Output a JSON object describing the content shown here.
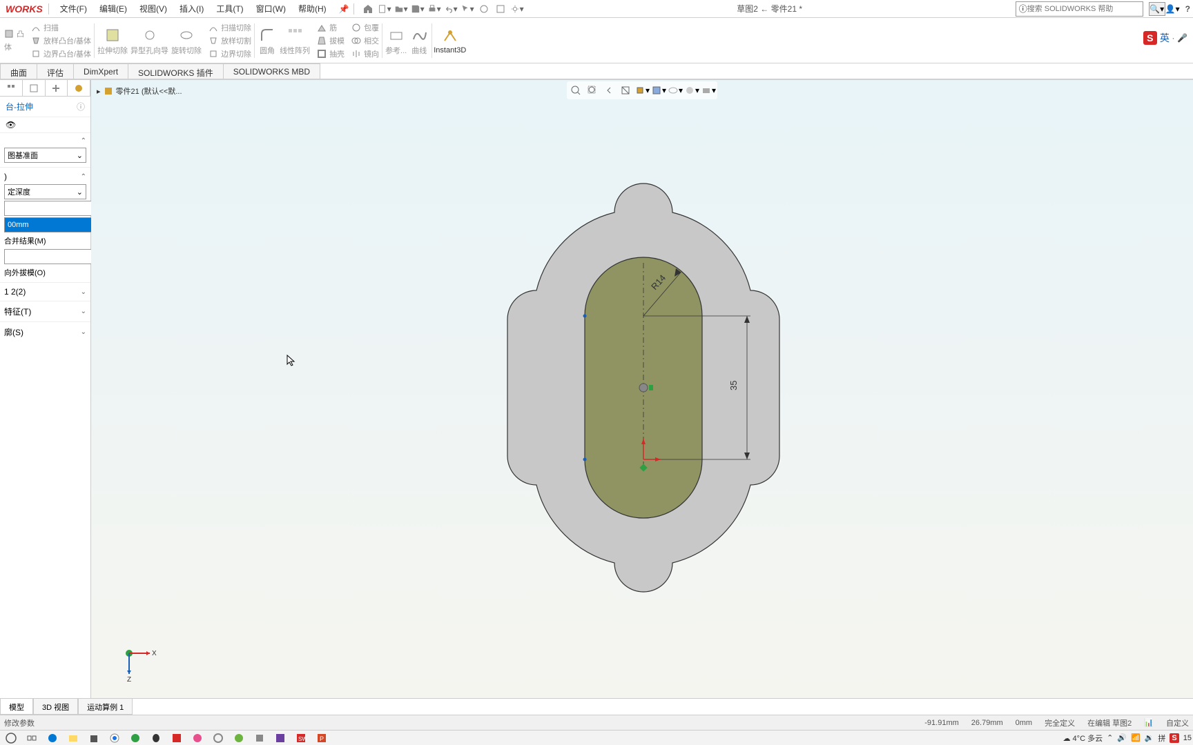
{
  "app": {
    "logo": "WORKS",
    "doc_title": "草图2 ← 零件21 *",
    "search_placeholder": "搜索 SOLIDWORKS 帮助"
  },
  "menu": [
    "文件(F)",
    "编辑(E)",
    "视图(V)",
    "插入(I)",
    "工具(T)",
    "窗口(W)",
    "帮助(H)"
  ],
  "ribbon": {
    "sweep": "扫描",
    "loft": "放样凸台/基体",
    "boundary": "边界凸台/基体",
    "extrude_cut": "拉伸切除",
    "wizard": "异型孔向导",
    "revolve_cut": "旋转切除",
    "sweep_cut": "扫描切除",
    "loft_cut": "放样切割",
    "boundary_cut": "边界切除",
    "fillet": "圆角",
    "linear_pattern": "线性阵列",
    "rib": "筋",
    "draft": "拔模",
    "shell": "抽壳",
    "wrap": "包覆",
    "intersect": "相交",
    "mirror": "镜向",
    "ref_geom": "参考...",
    "curves": "曲线",
    "instant3d": "Instant3D"
  },
  "tabs": [
    "曲面",
    "评估",
    "DimXpert",
    "SOLIDWORKS 插件",
    "SOLIDWORKS MBD"
  ],
  "breadcrumb": "零件21  (默认<<默...",
  "panel": {
    "title": "台-拉伸",
    "plane_dd": "图基准面",
    "depth_dd": "定深度",
    "depth_val": "00mm",
    "merge": "合并结果(M)",
    "draft": "向外拔模(O)",
    "dir2": "1 2(2)",
    "thin": "特征(T)",
    "contours": "廓(S)"
  },
  "dims": {
    "r": "R14",
    "h": "35"
  },
  "axes": {
    "x": "X",
    "z": "Z"
  },
  "bottom_tabs": [
    "模型",
    "3D 视图",
    "运动算例 1"
  ],
  "status": {
    "msg": "修改参数",
    "x": "-91.91mm",
    "y": "26.79mm",
    "z": "0mm",
    "def": "完全定义",
    "edit": "在编辑 草图2",
    "custom": "自定义"
  },
  "system": {
    "weather": "4°C 多云",
    "ime": "英",
    "time": "15"
  }
}
